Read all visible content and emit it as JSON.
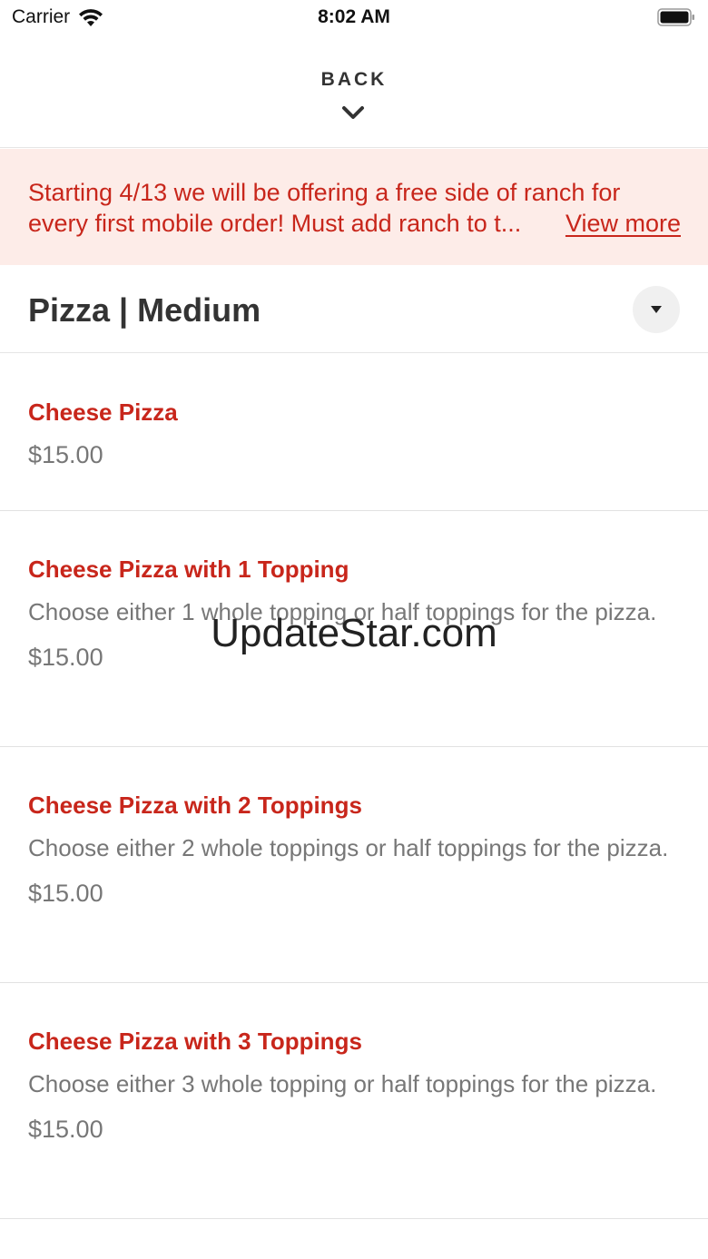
{
  "status_bar": {
    "carrier": "Carrier",
    "time": "8:02 AM"
  },
  "nav": {
    "back_label": "BACK"
  },
  "promo": {
    "line1": "Starting 4/13 we will be offering a free side of ranch for",
    "line2": "every first mobile order! Must add ranch to t...",
    "view_more": "View more"
  },
  "section": {
    "title": "Pizza | Medium"
  },
  "menu_items": [
    {
      "name": "Cheese Pizza",
      "description": "",
      "price": "$15.00"
    },
    {
      "name": "Cheese Pizza with 1 Topping",
      "description": "Choose either 1 whole topping or half toppings for the pizza.",
      "price": "$15.00"
    },
    {
      "name": "Cheese Pizza with 2 Toppings",
      "description": "Choose either 2 whole toppings or half toppings for the pizza.",
      "price": "$15.00"
    },
    {
      "name": "Cheese Pizza with 3 Toppings",
      "description": "Choose either 3 whole topping or half toppings for the pizza.",
      "price": "$15.00"
    }
  ],
  "watermark": "UpdateStar.com",
  "colors": {
    "accent": "#c8261b",
    "promo_bg": "#fdece8",
    "muted_text": "#777777"
  },
  "icons": {
    "wifi": "wifi-icon",
    "battery": "battery-icon",
    "back": "chevron-down-icon",
    "dropdown": "caret-down-icon"
  }
}
